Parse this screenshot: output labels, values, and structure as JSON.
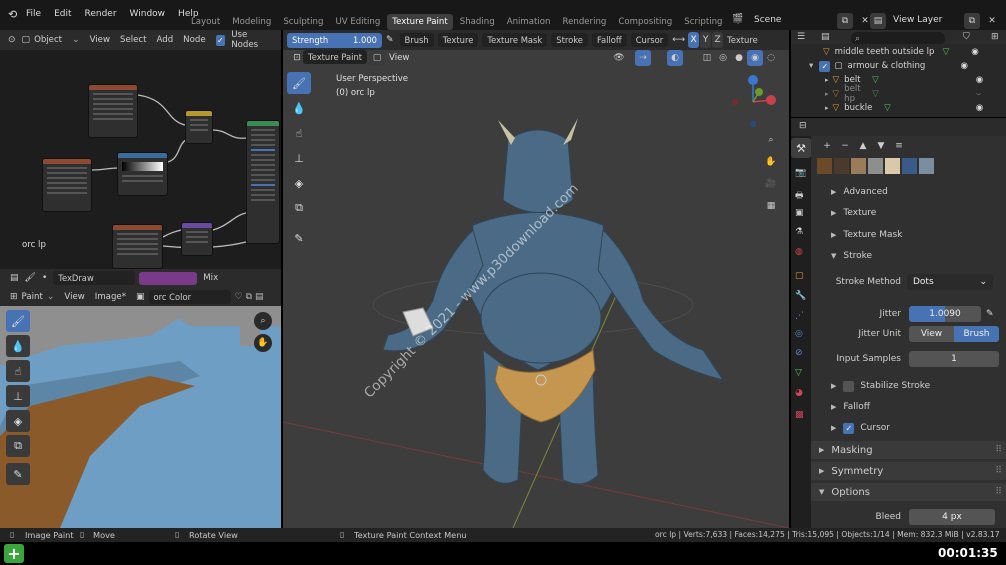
{
  "menu": {
    "items": [
      "File",
      "Edit",
      "Render",
      "Window",
      "Help"
    ]
  },
  "workspaces": {
    "tabs": [
      "Layout",
      "Modeling",
      "Sculpting",
      "UV Editing",
      "Texture Paint",
      "Shading",
      "Animation",
      "Rendering",
      "Compositing",
      "Scripting"
    ],
    "active": "Texture Paint",
    "add": "+"
  },
  "scene": {
    "label": "Scene",
    "view_layer": "View Layer"
  },
  "node_editor": {
    "header": {
      "mode": "Object",
      "items": [
        "View",
        "Select",
        "Add",
        "Node"
      ],
      "use_nodes": "Use Nodes"
    },
    "material_label": "orc lp",
    "footer": {
      "node_name": "TexDraw",
      "blend": "Mix"
    }
  },
  "image_editor": {
    "header": {
      "mode": "Paint",
      "items": [
        "View",
        "Image*"
      ],
      "image_name": "orc Color"
    }
  },
  "viewport": {
    "toolbar": {
      "strength_label": "Strength",
      "strength_value": "1.000",
      "brush": "Brush",
      "texture": "Texture",
      "texture_mask": "Texture Mask",
      "stroke": "Stroke",
      "falloff": "Falloff",
      "cursor": "Cursor",
      "axes": [
        "X",
        "Y",
        "Z"
      ],
      "texture_trunc": "Texture"
    },
    "header": {
      "mode": "Texture Paint",
      "view": "View"
    },
    "overlay": {
      "perspective": "User Perspective",
      "object": "(0) orc lp"
    },
    "watermark": "Copyright © 2021 - www.p30download.com",
    "gizmo": {
      "x": "X",
      "y": "Y",
      "z": "Z"
    }
  },
  "outliner": {
    "rows": [
      {
        "label": "middle teeth outside lp",
        "type": "mesh",
        "indent": 1
      },
      {
        "label": "armour & clothing",
        "type": "collection",
        "indent": 0
      },
      {
        "label": "belt",
        "type": "mesh",
        "indent": 1
      },
      {
        "label": "belt hp",
        "type": "mesh",
        "indent": 1
      },
      {
        "label": "buckle",
        "type": "mesh",
        "indent": 1
      }
    ]
  },
  "properties": {
    "swatch_colors": [
      "#6b4a2a",
      "#4a3a2c",
      "#9a7b5a",
      "#8e8e8e",
      "#d9c9a8",
      "#3a5a8a",
      "#7a8ea0"
    ],
    "sections": {
      "advanced": "Advanced",
      "texture": "Texture",
      "texture_mask": "Texture Mask",
      "stroke": "Stroke",
      "stroke_method_label": "Stroke Method",
      "stroke_method_value": "Dots",
      "jitter_label": "Jitter",
      "jitter_value": "1.0090",
      "jitter_unit_label": "Jitter Unit",
      "jitter_unit_view": "View",
      "jitter_unit_brush": "Brush",
      "input_samples_label": "Input Samples",
      "input_samples_value": "1",
      "stabilize_stroke": "Stabilize Stroke",
      "falloff": "Falloff",
      "cursor": "Cursor",
      "masking": "Masking",
      "symmetry": "Symmetry",
      "options": "Options",
      "bleed_label": "Bleed",
      "bleed_value": "4 px"
    }
  },
  "statusbar": {
    "left1": "Image Paint",
    "left2": "Move",
    "left3": "Rotate View",
    "left4": "Texture Paint Context Menu",
    "right": "orc lp | Verts:7,633 | Faces:14,275 | Tris:15,095 | Objects:1/14 | Mem: 832.3 MiB | v2.83.17"
  },
  "video": {
    "timestamp": "00:01:35",
    "add_icon": "+"
  }
}
